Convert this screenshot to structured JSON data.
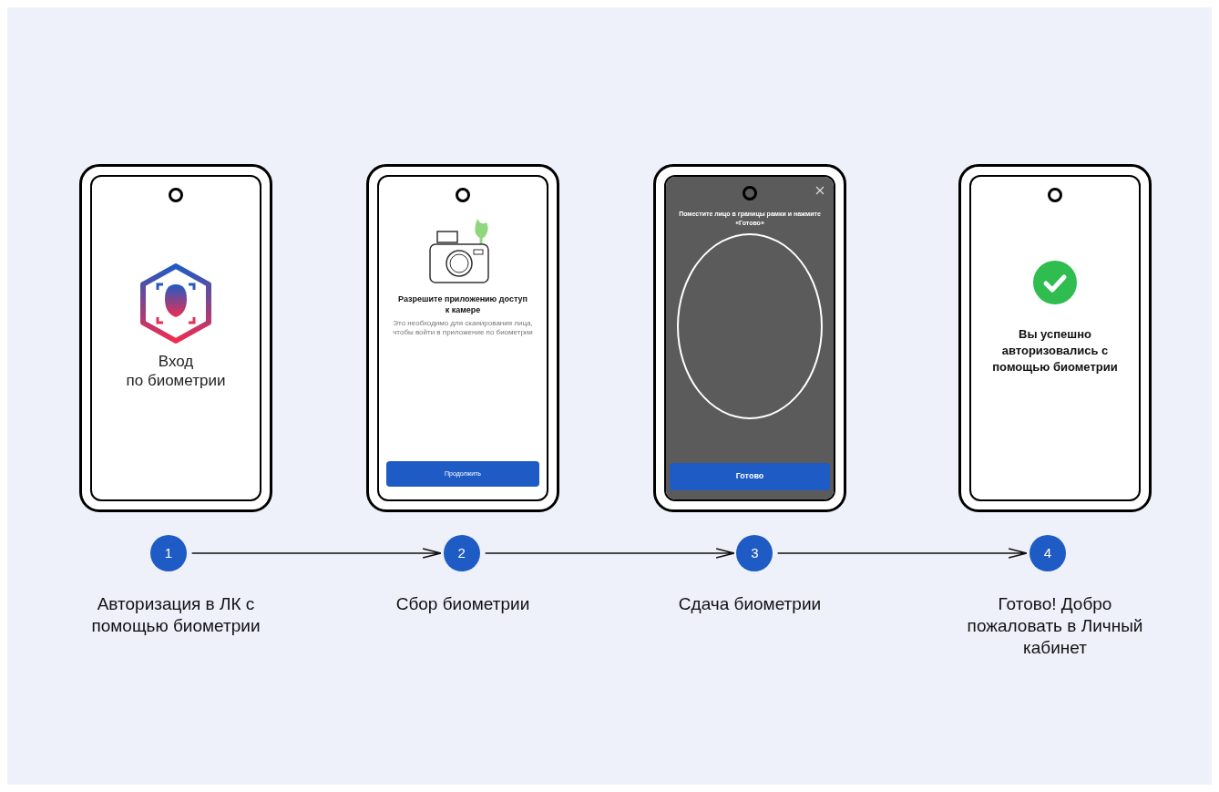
{
  "steps": [
    {
      "number": "1",
      "caption": "Авторизация в ЛК с помощью биометрии",
      "screen": {
        "kind": "login",
        "title": "Вход",
        "subtitle": "по биометрии"
      }
    },
    {
      "number": "2",
      "caption": "Сбор биометрии",
      "screen": {
        "kind": "permission",
        "title": "Разрешите приложению доступ к камере",
        "body": "Это необходимо для сканирования лица, чтобы войти в приложение по биометрии",
        "button": "Продолжить"
      }
    },
    {
      "number": "3",
      "caption": "Сдача биометрии",
      "screen": {
        "kind": "camera",
        "instruction": "Поместите лицо в границы рамки и нажмите «Готово»",
        "button": "Готово"
      }
    },
    {
      "number": "4",
      "caption": "Готово! Добро пожаловать в Личный кабинет",
      "screen": {
        "kind": "success",
        "message": "Вы успешно авторизовались с помощью биометрии"
      }
    }
  ]
}
